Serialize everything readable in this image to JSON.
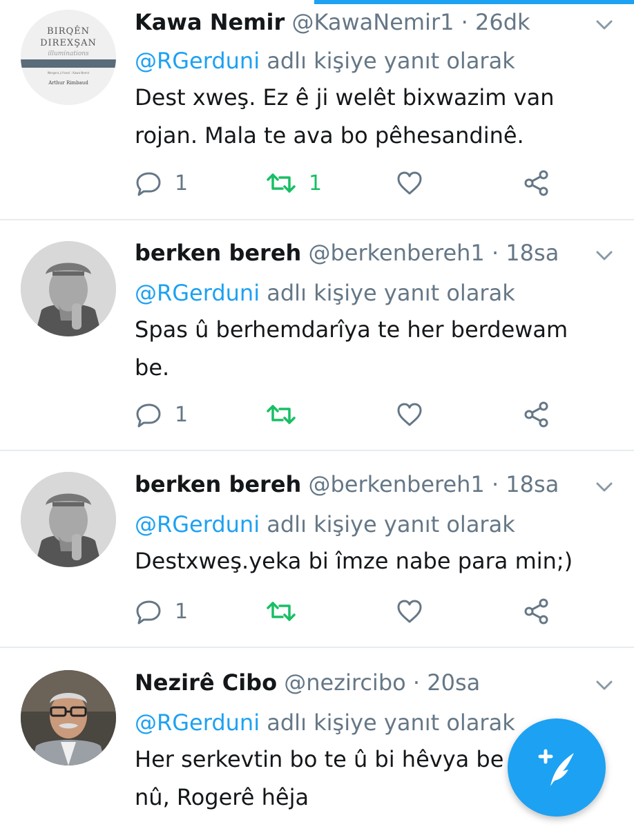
{
  "reply_mention": "@RGerduni",
  "reply_suffix": "adlı kişiye yanıt olarak",
  "colors": {
    "accent": "#1da1f2",
    "retweet_active": "#17bf63",
    "muted": "#657786"
  },
  "tweets": [
    {
      "name": "Kawa Nemir",
      "handle": "@KawaNemir1",
      "time": "26dk",
      "text_lines": [
        "Dest xweş. Ez ê ji welêt bixwazim van",
        "rojan. Mala te ava bo pêhesandinê."
      ],
      "reply_count": "1",
      "retweet_count": "1",
      "avatar": {
        "type": "book-cover",
        "title_line1": "BIRQÊN",
        "title_line2": "DIREXŞAN",
        "subtitle": "illuminations",
        "translator": "Wergera ji fransî : Kawa Nemir",
        "author": "Arthur Rimbaud"
      }
    },
    {
      "name": "berken bereh",
      "handle": "@berkenbereh1",
      "time": "18sa",
      "text_lines": [
        "Spas û berhemdarîya te her berdewam",
        "be."
      ],
      "reply_count": "1",
      "retweet_count": "",
      "avatar": {
        "type": "photo-bw-man-cap"
      }
    },
    {
      "name": "berken bereh",
      "handle": "@berkenbereh1",
      "time": "18sa",
      "text_lines": [
        "Destxweş.yeka bi îmze nabe para min;)"
      ],
      "reply_count": "1",
      "retweet_count": "",
      "avatar": {
        "type": "photo-bw-man-cap"
      }
    },
    {
      "name": "Nezirê Cibo",
      "handle": "@nezircibo",
      "time": "20sa",
      "text_lines": [
        "Her serkevtin bo te û bi hêvya be",
        "nû, Rogerê hêja"
      ],
      "reply_count": "",
      "retweet_count": "",
      "avatar": {
        "type": "photo-man-glasses"
      }
    }
  ],
  "fab": {
    "icon": "compose-feather-icon"
  }
}
